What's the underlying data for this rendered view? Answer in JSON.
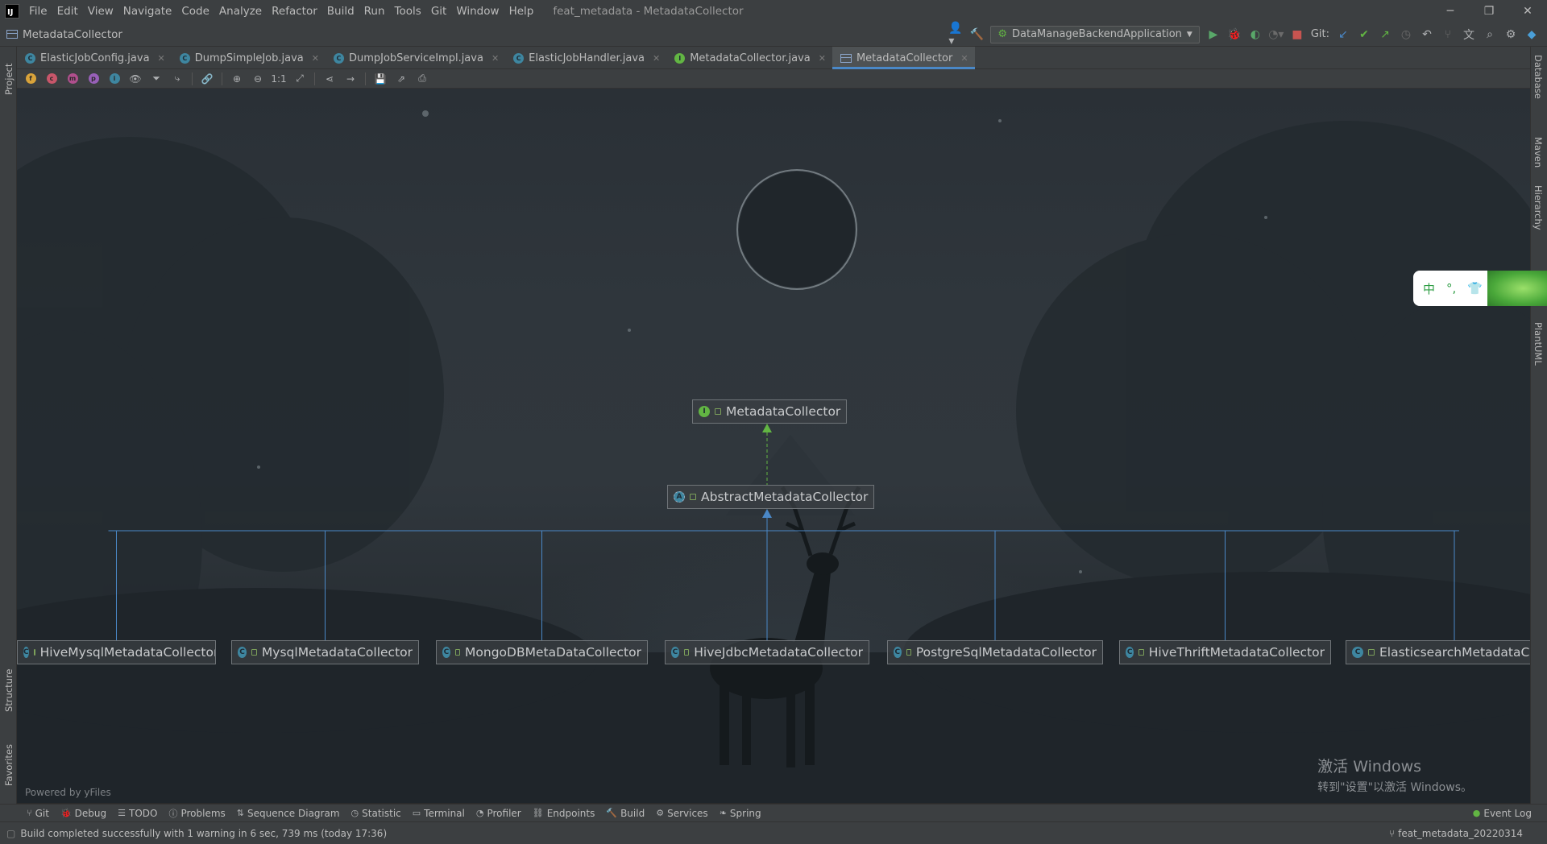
{
  "window": {
    "title": "feat_metadata - MetadataCollector",
    "logo_text": "IJ",
    "controls": {
      "minimize": "─",
      "restore": "❐",
      "close": "✕"
    }
  },
  "menu": [
    "File",
    "Edit",
    "View",
    "Navigate",
    "Code",
    "Analyze",
    "Refactor",
    "Build",
    "Run",
    "Tools",
    "Git",
    "Window",
    "Help"
  ],
  "navbar": {
    "breadcrumb": "MetadataCollector",
    "run_config": "DataManageBackendApplication",
    "git_label": "Git:"
  },
  "tabs": [
    {
      "label": "ElasticJobConfig.java",
      "kind": "C",
      "active": false
    },
    {
      "label": "DumpSimpleJob.java",
      "kind": "C",
      "active": false
    },
    {
      "label": "DumpJobServiceImpl.java",
      "kind": "C",
      "active": false
    },
    {
      "label": "ElasticJobHandler.java",
      "kind": "C",
      "active": false
    },
    {
      "label": "MetadataCollector.java",
      "kind": "I",
      "active": false
    },
    {
      "label": "MetadataCollector",
      "kind": "UML",
      "active": true
    }
  ],
  "toolbar": {
    "filters": [
      {
        "icon": "field-filter-icon",
        "letter": "f",
        "color": "#d9a33a"
      },
      {
        "icon": "constructor-filter-icon",
        "letter": "c",
        "color": "#c8566a"
      },
      {
        "icon": "method-filter-icon",
        "letter": "m",
        "color": "#b04f8d"
      },
      {
        "icon": "property-filter-icon",
        "letter": "p",
        "color": "#9860b8"
      },
      {
        "icon": "inner-class-filter-icon",
        "letter": "i",
        "color": "#3e86a0"
      }
    ],
    "actual_size_label": "1:1"
  },
  "left_strip": {
    "project": "Project",
    "structure": "Structure",
    "favorites": "Favorites"
  },
  "right_strip": {
    "database": "Database",
    "maven": "Maven",
    "hierarchy": "Hierarchy",
    "plantuml": "PlantUML"
  },
  "diagram": {
    "root": {
      "name": "MetadataCollector",
      "kind": "interface"
    },
    "abstract": {
      "name": "AbstractMetadataCollector",
      "kind": "abstract"
    },
    "children": [
      {
        "name": "HiveMysqlMetadataCollector"
      },
      {
        "name": "MysqlMetadataCollector"
      },
      {
        "name": "MongoDBMetaDataCollector"
      },
      {
        "name": "HiveJdbcMetadataCollector"
      },
      {
        "name": "PostgreSqlMetadataCollector"
      },
      {
        "name": "HiveThriftMetadataCollector"
      },
      {
        "name": "ElasticsearchMetadataCol"
      }
    ],
    "powered_by": "Powered by yFiles"
  },
  "watermark": {
    "line1": "激活 Windows",
    "line2": "转到\"设置\"以激活 Windows。"
  },
  "ime": {
    "lang": "中",
    "punct": "°,",
    "shirt": "👕"
  },
  "tool_windows": [
    "Git",
    "Debug",
    "TODO",
    "Problems",
    "Sequence Diagram",
    "Statistic",
    "Terminal",
    "Profiler",
    "Endpoints",
    "Build",
    "Services",
    "Spring"
  ],
  "event_log": "Event Log",
  "status": {
    "message": "Build completed successfully with 1 warning in 6 sec, 739 ms (today 17:36)",
    "branch": "feat_metadata_20220314"
  },
  "colors": {
    "accent": "#4a88c7",
    "edge": "#4a88c7",
    "realization": "#62b543"
  }
}
